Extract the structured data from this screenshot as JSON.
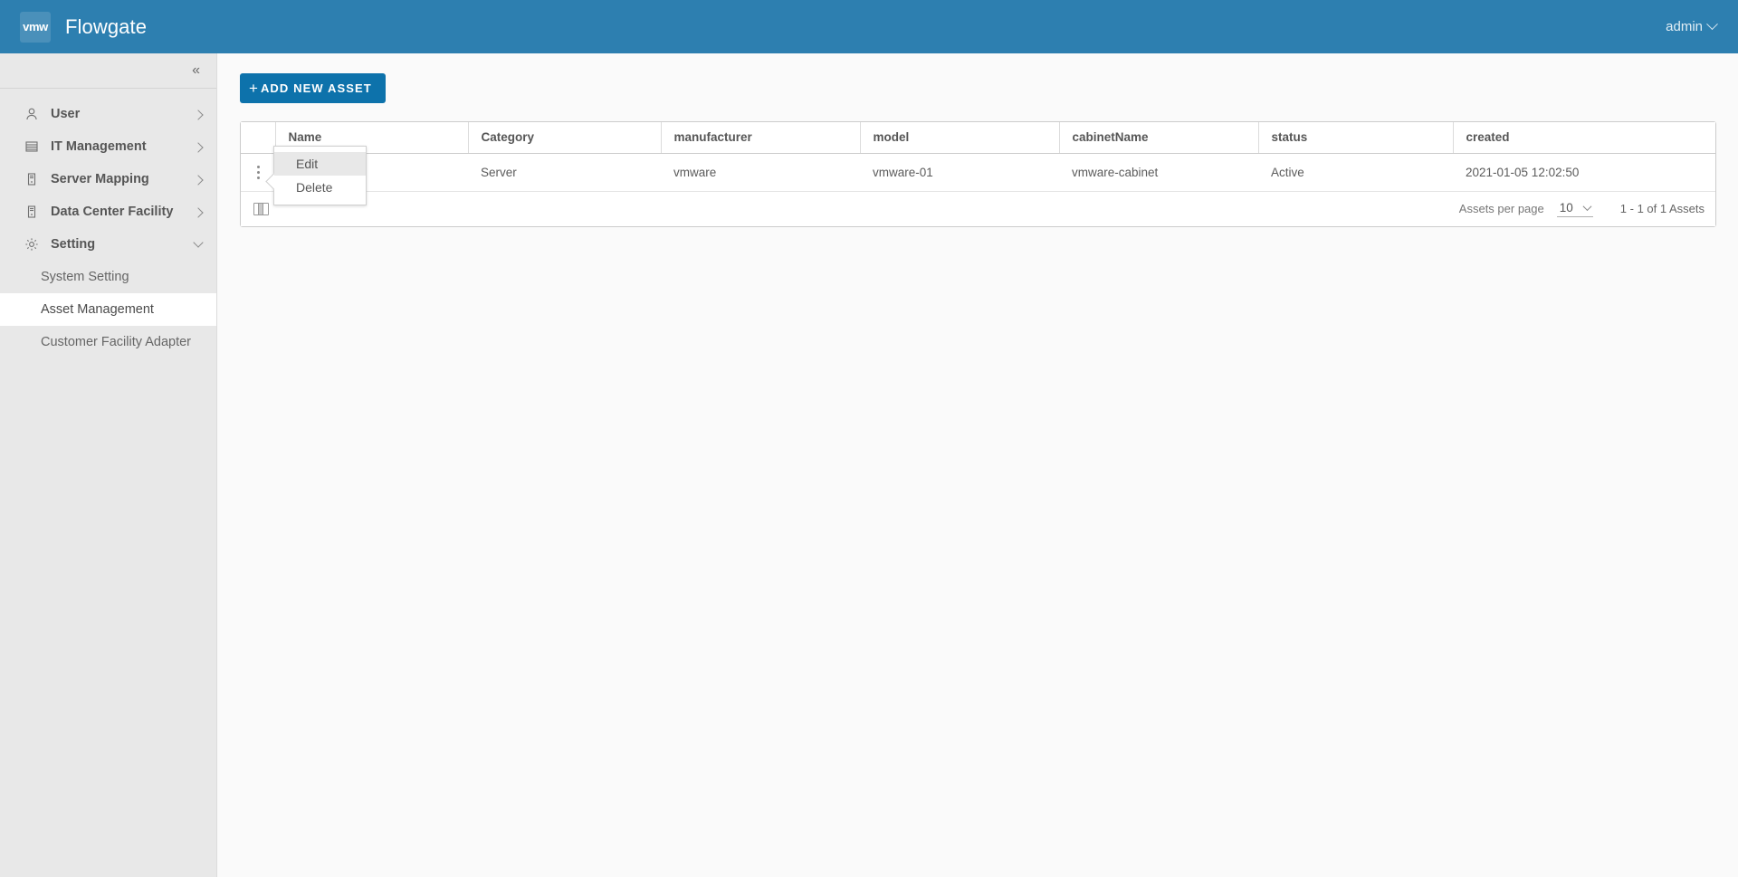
{
  "header": {
    "logo_text": "vmw",
    "app_title": "Flowgate",
    "user_label": "admin",
    "user_caret_icon": "chevron-down-icon",
    "background_color": "#2d7fb0"
  },
  "sidebar": {
    "collapse_icon": "«",
    "background_color": "#e8e8e8",
    "items": [
      {
        "label": "User",
        "icon": "user-icon",
        "caret": "chevron-right-icon",
        "expanded": false
      },
      {
        "label": "IT Management",
        "icon": "list-icon",
        "caret": "chevron-right-icon",
        "expanded": false
      },
      {
        "label": "Server Mapping",
        "icon": "server-icon",
        "caret": "chevron-right-icon",
        "expanded": false
      },
      {
        "label": "Data Center Facility",
        "icon": "server-icon",
        "caret": "chevron-right-icon",
        "expanded": false
      },
      {
        "label": "Setting",
        "icon": "gear-icon",
        "caret": "chevron-down-icon",
        "expanded": true
      }
    ],
    "sub_items": [
      {
        "label": "System Setting",
        "active": false
      },
      {
        "label": "Asset Management",
        "active": true
      },
      {
        "label": "Customer Facility Adapter",
        "active": false
      }
    ]
  },
  "main": {
    "add_button": {
      "label": "ADD NEW ASSET",
      "plus_icon": "+",
      "color": "#0d72ab"
    },
    "table": {
      "columns": [
        "Name",
        "Category",
        "manufacturer",
        "model",
        "cabinetName",
        "status",
        "created"
      ],
      "rows": [
        {
          "name": "",
          "category": "Server",
          "manufacturer": "vmware",
          "model": "vmware-01",
          "cabinetName": "vmware-cabinet",
          "status": "Active",
          "created": "2021-01-05 12:02:50",
          "actions_icon": "kebab-menu-icon"
        }
      ]
    },
    "context_menu": {
      "visible": true,
      "items": [
        {
          "label": "Edit",
          "highlighted": true
        },
        {
          "label": "Delete",
          "highlighted": false
        }
      ]
    },
    "footer": {
      "column_toggle_icon": "columns-icon",
      "per_page_label": "Assets per page",
      "per_page_value": "10",
      "per_page_caret": "chevron-down-icon",
      "range_text": "1 - 1 of 1 Assets"
    }
  }
}
